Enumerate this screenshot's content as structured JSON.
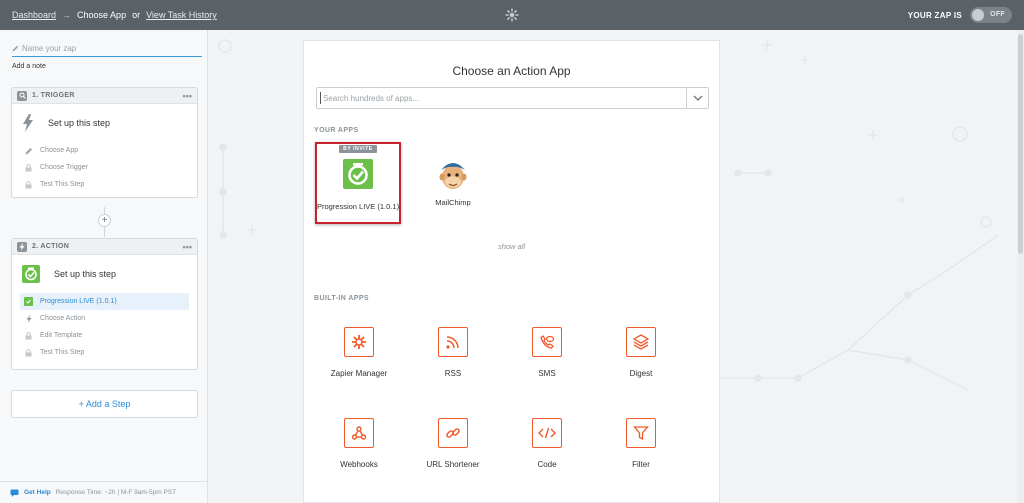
{
  "topbar": {
    "dashboard_link": "Dashboard",
    "arrow": "→",
    "current": "Choose App",
    "or": "or",
    "history_link": "View Task History",
    "zap_is": "YOUR ZAP IS",
    "toggle_label": "OFF",
    "center_icon": "gear-icon"
  },
  "sidebar": {
    "zap_name_placeholder": "Name your zap",
    "add_note": "Add a note",
    "trigger": {
      "title": "1. TRIGGER",
      "dots": "•••",
      "setup": "Set up this step",
      "rows": [
        "Choose App",
        "Choose Trigger",
        "Test This Step"
      ]
    },
    "action": {
      "title": "2. ACTION",
      "dots": "•••",
      "setup": "Set up this step",
      "active_row": "Progression LIVE (1.0.1)",
      "rows": [
        "Choose Action",
        "Edit Template",
        "Test This Step"
      ]
    },
    "plus": "+",
    "add_step": "+ Add a Step",
    "help": {
      "link": "Get Help",
      "text": "Response Time: ~2h | M-F 9am-5pm PST"
    }
  },
  "panel": {
    "title": "Choose an Action App",
    "search_placeholder": "Search hundreds of apps...",
    "your_apps_label": "YOUR APPS",
    "your_apps": [
      {
        "name": "Progression LIVE (1.0.1)",
        "badge": "BY INVITE",
        "selected": true,
        "icon": "progression-check-icon"
      },
      {
        "name": "MailChimp",
        "icon": "mailchimp-icon"
      }
    ],
    "show_all": "show all",
    "builtin_label": "BUILT-IN APPS",
    "builtin_apps": [
      {
        "name": "Zapier Manager",
        "icon": "zapier-manager-icon"
      },
      {
        "name": "RSS",
        "icon": "rss-icon"
      },
      {
        "name": "SMS",
        "icon": "sms-icon"
      },
      {
        "name": "Digest",
        "icon": "digest-icon"
      },
      {
        "name": "Webhooks",
        "icon": "webhooks-icon"
      },
      {
        "name": "URL Shortener",
        "icon": "url-shortener-icon"
      },
      {
        "name": "Code",
        "icon": "code-icon"
      },
      {
        "name": "Filter",
        "icon": "filter-icon"
      }
    ]
  },
  "colors": {
    "topbar": "#5a6268",
    "accent_blue": "#2a8bd6",
    "builtin_orange": "#f0592a",
    "selected_border": "#c5232d",
    "progression_green": "#6cc04a"
  }
}
